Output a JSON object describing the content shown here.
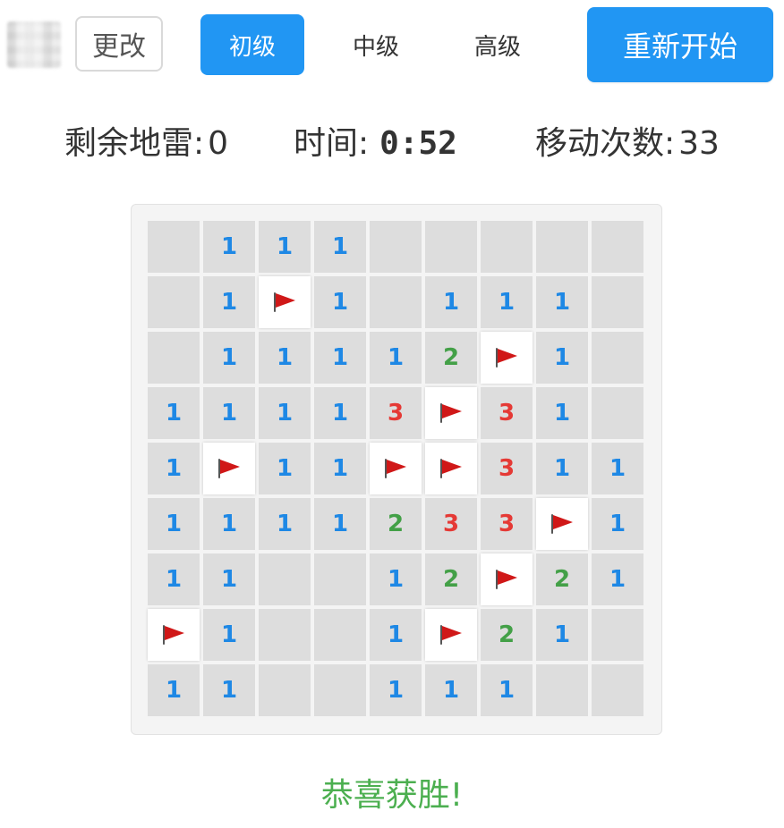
{
  "toolbar": {
    "change_label": "更改",
    "levels": [
      {
        "label": "初级",
        "active": true
      },
      {
        "label": "中级",
        "active": false
      },
      {
        "label": "高级",
        "active": false
      }
    ],
    "restart_label": "重新开始"
  },
  "status": {
    "mines_label": "剩余地雷:",
    "mines_value": "0",
    "time_label": "时间:",
    "time_value": "0:52",
    "moves_label": "移动次数:",
    "moves_value": "33"
  },
  "board": {
    "rows": [
      [
        "",
        "1",
        "1",
        "1",
        "",
        "",
        "",
        "",
        ""
      ],
      [
        "",
        "1",
        "F",
        "1",
        "",
        "1",
        "1",
        "1",
        ""
      ],
      [
        "",
        "1",
        "1",
        "1",
        "1",
        "2",
        "F",
        "1",
        ""
      ],
      [
        "1",
        "1",
        "1",
        "1",
        "3",
        "F",
        "3",
        "1",
        ""
      ],
      [
        "1",
        "F",
        "1",
        "1",
        "F",
        "F",
        "3",
        "1",
        "1"
      ],
      [
        "1",
        "1",
        "1",
        "1",
        "2",
        "3",
        "3",
        "F",
        "1"
      ],
      [
        "1",
        "1",
        "",
        "",
        "1",
        "2",
        "F",
        "2",
        "1"
      ],
      [
        "F",
        "1",
        "",
        "",
        "1",
        "F",
        "2",
        "1",
        ""
      ],
      [
        "1",
        "1",
        "",
        "",
        "1",
        "1",
        "1",
        "",
        ""
      ]
    ],
    "number_colors": {
      "1": "#1e88e5",
      "2": "#43a047",
      "3": "#e53935"
    },
    "flag_icon": "red-flag-icon"
  },
  "message": "恭喜获胜!",
  "colors": {
    "accent": "#2196f3",
    "success": "#4caf50",
    "cell": "#dddddd"
  }
}
